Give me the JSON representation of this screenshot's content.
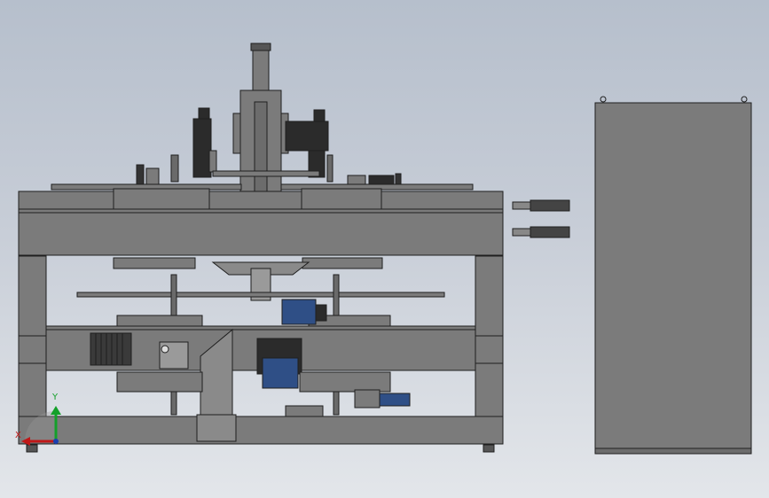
{
  "viewport": {
    "background_top": "#b6bfcc",
    "background_bottom": "#e3e6ea"
  },
  "model": {
    "part_color": "#7b7b7b",
    "edge_color": "#1f1f1f",
    "dark_part_color": "#2b2b2b",
    "motor_color": "#2f4f86"
  },
  "triad": {
    "y_label": "Y",
    "x_label": "X",
    "y_color": "#14a02a",
    "x_color": "#c01818",
    "z_color": "#1a3fb0"
  }
}
